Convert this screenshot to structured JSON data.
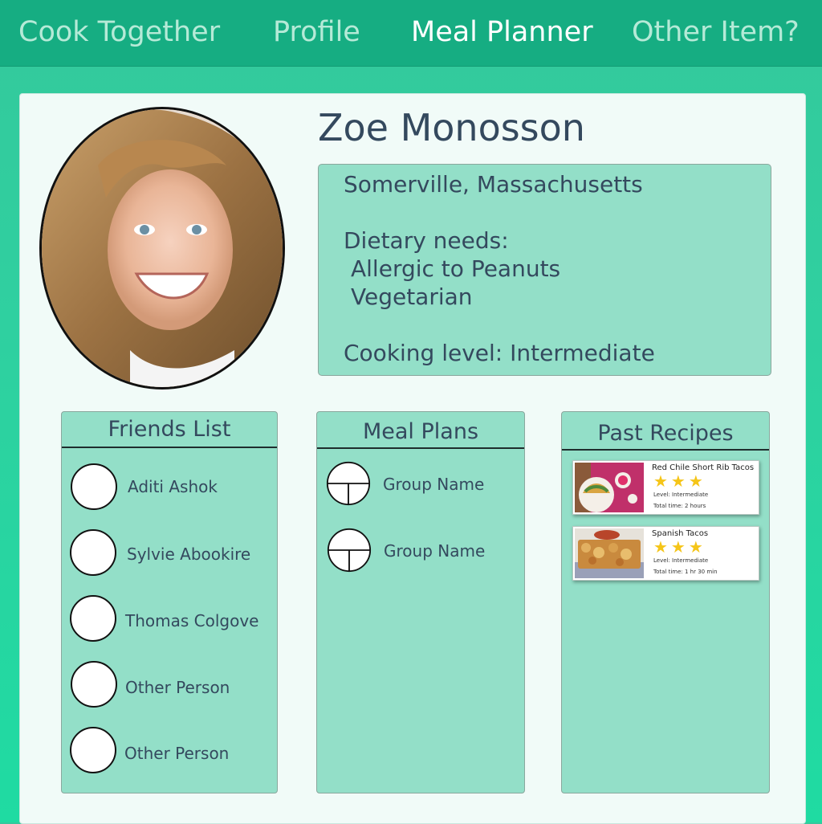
{
  "nav": {
    "items": [
      {
        "label": "Cook Together",
        "active": false
      },
      {
        "label": "Profile",
        "active": false
      },
      {
        "label": "Meal Planner",
        "active": true
      },
      {
        "label": "Other Item?",
        "active": false
      }
    ]
  },
  "profile": {
    "name": "Zoe Monosson",
    "location": "Somerville, Massachusetts",
    "dietary_heading": "Dietary needs:",
    "dietary_needs": [
      "Allergic to Peanuts",
      "Vegetarian"
    ],
    "cooking_level": "Cooking level: Intermediate"
  },
  "friends": {
    "title": "Friends List",
    "items": [
      "Aditi Ashok",
      "Sylvie Abookire",
      "Thomas Colgove",
      "Other Person",
      "Other Person"
    ]
  },
  "meal_plans": {
    "title": "Meal Plans",
    "items": [
      "Group Name",
      "Group Name"
    ]
  },
  "past_recipes": {
    "title": "Past Recipes",
    "items": [
      {
        "title": "Red Chile Short Rib Tacos",
        "stars": "★★★",
        "rating": 3,
        "level": "Level: Intermediate",
        "time": "Total time: 2 hours"
      },
      {
        "title": "Spanish Tacos",
        "stars": "★★★",
        "rating": 3,
        "level": "Level: Intermediate",
        "time": "Total time: 1 hr 30 min"
      }
    ]
  },
  "colors": {
    "nav_bg": "#16ad82",
    "panel_bg": "#93dfc8",
    "text": "#34495e",
    "star": "#f5c518"
  }
}
